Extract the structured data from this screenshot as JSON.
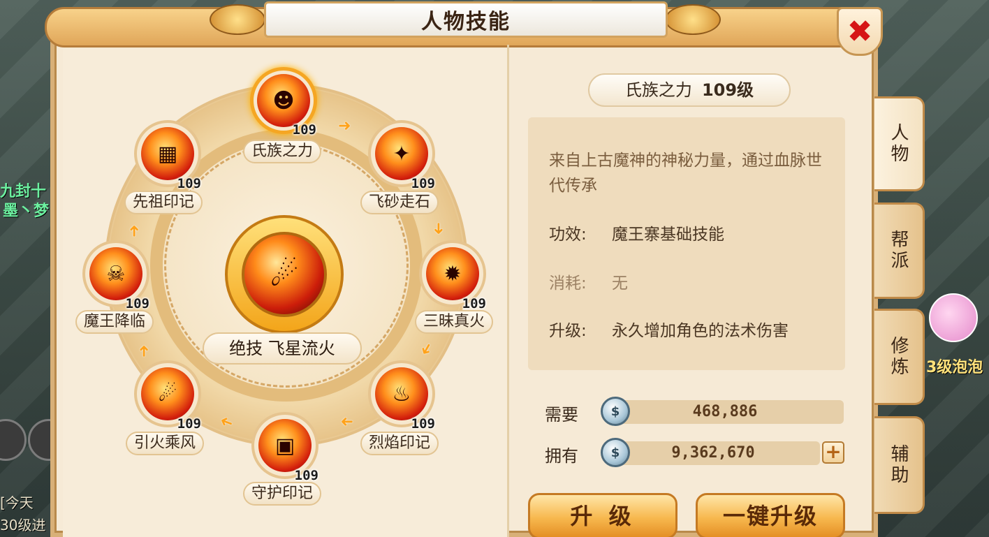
{
  "window": {
    "title": "人物技能",
    "close_symbol": "✖"
  },
  "skills": [
    {
      "name": "氏族之力",
      "level": "109",
      "active": true,
      "icon": "demon-face-icon"
    },
    {
      "name": "飞砂走石",
      "level": "109",
      "icon": "flying-rocks-icon"
    },
    {
      "name": "三昧真火",
      "level": "109",
      "icon": "fire-burst-icon"
    },
    {
      "name": "烈焰印记",
      "level": "109",
      "icon": "flame-mark-icon"
    },
    {
      "name": "守护印记",
      "level": "109",
      "icon": "guard-mark-icon"
    },
    {
      "name": "引火乘风",
      "level": "109",
      "icon": "fire-wind-icon"
    },
    {
      "name": "魔王降临",
      "level": "109",
      "icon": "demon-king-icon"
    },
    {
      "name": "先祖印记",
      "level": "109",
      "icon": "ancestor-mark-icon"
    }
  ],
  "center_skill": {
    "label": "绝技  飞星流火",
    "icon": "meteor-fire-icon"
  },
  "detail": {
    "name": "氏族之力",
    "level_text": "109级",
    "description": "来自上古魔神的神秘力量，通过血脉世代传承",
    "effect_key": "功效:",
    "effect_value": "魔王寨基础技能",
    "cost_key": "消耗:",
    "cost_value": "无",
    "upgrade_key": "升级:",
    "upgrade_value": "永久增加角色的法术伤害"
  },
  "resources": {
    "need_label": "需要",
    "need_value": "468,886",
    "have_label": "拥有",
    "have_value": "9,362,670",
    "plus": "+"
  },
  "buttons": {
    "upgrade": "升 级",
    "one_click_upgrade": "一键升级"
  },
  "tabs": [
    {
      "label": "人物",
      "active": true
    },
    {
      "label": "帮派"
    },
    {
      "label": "修炼"
    },
    {
      "label": "辅助"
    }
  ],
  "world": {
    "left_text_1": "九封十",
    "left_text_2": "墨丶梦",
    "chat_1": "[今天",
    "chat_2": "30级进",
    "right_text": "3级泡泡"
  },
  "colors": {
    "accent": "#f5a623",
    "panel": "#f6ead6",
    "close": "#d61616"
  }
}
